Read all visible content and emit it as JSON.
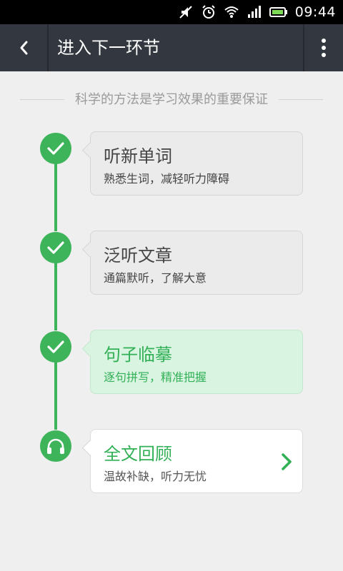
{
  "status_bar": {
    "time": "09:44",
    "icons": [
      "mute-icon",
      "alarm-icon",
      "wifi-icon",
      "signal-icon",
      "battery-icon"
    ]
  },
  "header": {
    "title": "进入下一环节",
    "back_icon": "back-chevron-icon",
    "menu_icon": "overflow-menu-icon"
  },
  "subtitle": "科学的方法是学习效果的重要保证",
  "steps": [
    {
      "title": "听新单词",
      "desc": "熟悉生词，减轻听力障碍",
      "state": "done",
      "icon": "check-icon"
    },
    {
      "title": "泛听文章",
      "desc": "通篇默听，了解大意",
      "state": "done",
      "icon": "check-icon"
    },
    {
      "title": "句子临摹",
      "desc": "逐句拼写，精准把握",
      "state": "done",
      "icon": "check-icon"
    },
    {
      "title": "全文回顾",
      "desc": "温故补缺，听力无忧",
      "state": "next",
      "icon": "headphones-icon"
    }
  ],
  "colors": {
    "accent_green": "#3db35a",
    "title_bar": "#333840",
    "background": "#efefef",
    "active_card": "#d9f5e2"
  }
}
